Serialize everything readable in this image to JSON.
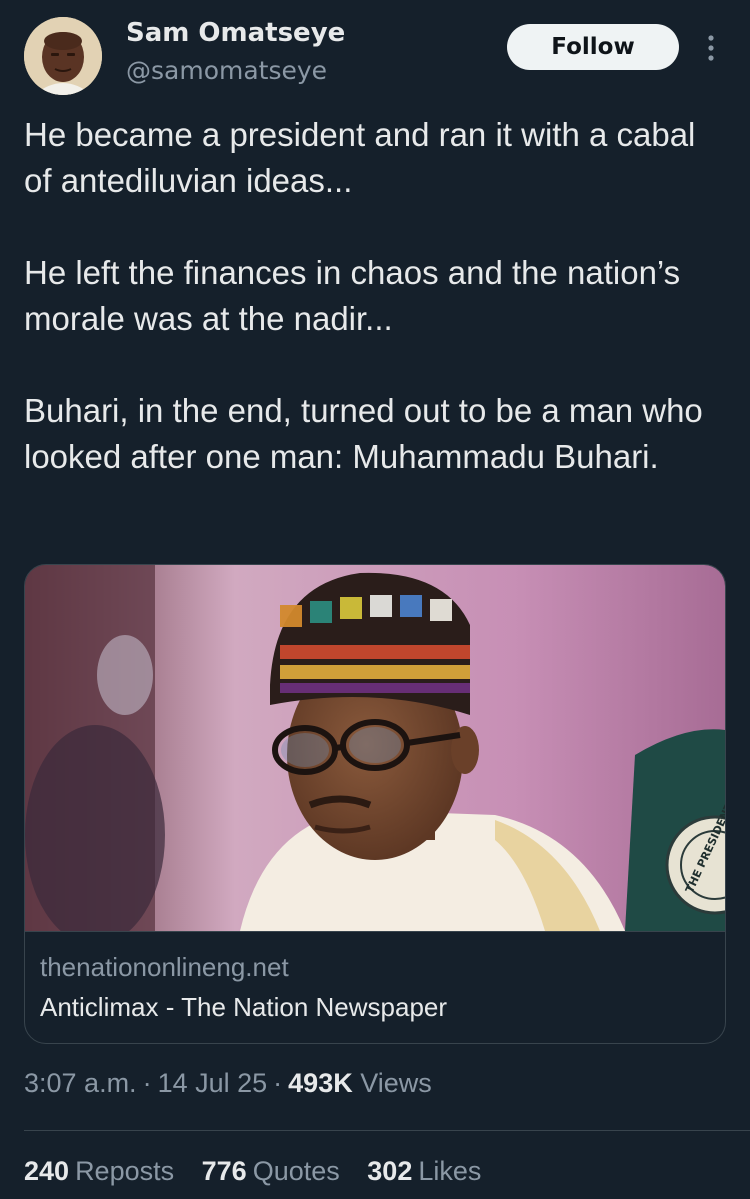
{
  "author": {
    "name": "Sam Omatseye",
    "handle": "@samomatseye"
  },
  "follow_label": "Follow",
  "tweet": {
    "paragraphs": [
      "He became a president and ran it with a cabal of antediluvian ideas...",
      "He left the finances in chaos and the nation’s morale was at the nadir...",
      "Buhari, in the end, turned out to be a man who looked after one man: Muhammadu Buhari."
    ]
  },
  "card": {
    "domain": "thenationonlineng.net",
    "title": "Anticlimax - The Nation Newspaper",
    "seal_text": "THE PRESIDENT"
  },
  "meta": {
    "time": "3:07 a.m.",
    "date": "14 Jul 25",
    "views_count": "493K",
    "views_label": "Views"
  },
  "stats": {
    "reposts_count": "240",
    "reposts_label": "Reposts",
    "quotes_count": "776",
    "quotes_label": "Quotes",
    "likes_count": "302",
    "likes_label": "Likes"
  },
  "colors": {
    "background": "#15202b",
    "text_primary": "#e7e9ea",
    "text_secondary": "#8b98a5",
    "border": "#38444d",
    "follow_bg": "#eff3f4"
  },
  "icons": {
    "more": "more-vertical-icon"
  }
}
